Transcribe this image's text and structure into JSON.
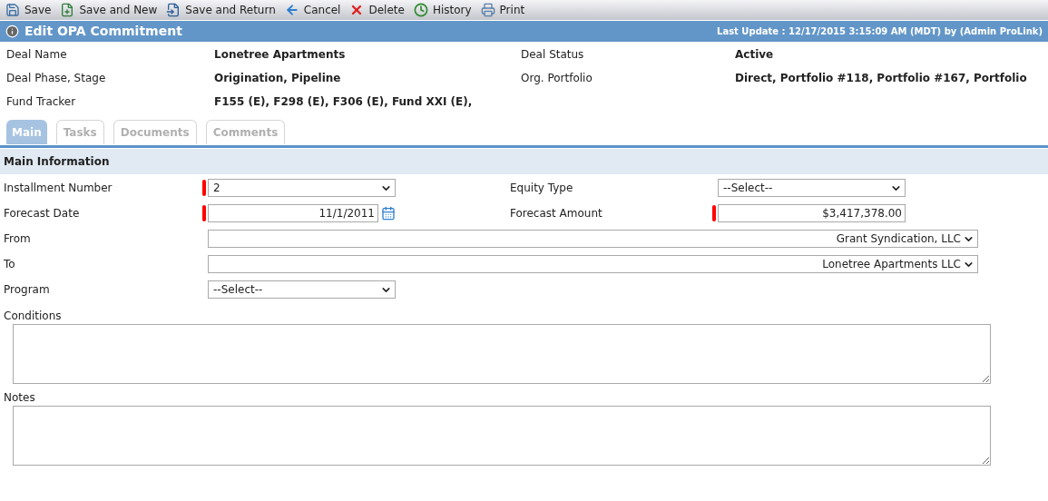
{
  "toolbar": [
    {
      "label": "Save",
      "kind": "save"
    },
    {
      "label": "Save and New",
      "kind": "new"
    },
    {
      "label": "Save and Return",
      "kind": "return"
    },
    {
      "label": "Cancel",
      "kind": "cancel"
    },
    {
      "label": "Delete",
      "kind": "delete"
    },
    {
      "label": "History",
      "kind": "history"
    },
    {
      "label": "Print",
      "kind": "print"
    }
  ],
  "header": {
    "title": "Edit OPA Commitment",
    "last_update": "Last Update : 12/17/2015 3:15:09 AM (MDT) by (Admin ProLink)"
  },
  "summary": [
    {
      "label": "Deal Name",
      "value": "Lonetree Apartments",
      "label_2": "Deal Status",
      "value_2": "Active"
    },
    {
      "label": "Deal Phase, Stage",
      "value": "Origination, Pipeline",
      "label_2": "Org. Portfolio",
      "value_2": "Direct, Portfolio #118, Portfolio #167, Portfolio"
    },
    {
      "label": "Fund Tracker",
      "value": "F155 (E), F298 (E), F306 (E), Fund XXI (E),"
    }
  ],
  "tabs": [
    {
      "label": "Main",
      "selected": true
    },
    {
      "label": "Tasks",
      "selected": false
    },
    {
      "label": "Documents",
      "selected": false
    },
    {
      "label": "Comments",
      "selected": false
    }
  ],
  "section": {
    "title": "Main Information"
  },
  "form_rows": [
    {
      "fields": [
        {
          "label": "Installment Number",
          "kind": "select",
          "value": "2",
          "required": true
        },
        {
          "label": "Equity Type",
          "kind": "select",
          "value": "--Select--",
          "required": false
        }
      ]
    },
    {
      "fields": [
        {
          "label": "Forecast Date",
          "kind": "date",
          "value": "11/1/2011",
          "required": true
        },
        {
          "label": "Forecast Amount",
          "kind": "text",
          "value": "$3,417,378.00",
          "required": true
        }
      ]
    },
    {
      "fields": [
        {
          "label": "From",
          "kind": "wide-select",
          "value": "Grant Syndication, LLC",
          "required": false
        }
      ]
    },
    {
      "fields": [
        {
          "label": "To",
          "kind": "wide-select",
          "value": "Lonetree Apartments LLC",
          "required": false
        }
      ]
    },
    {
      "fields": [
        {
          "label": "Program",
          "kind": "select",
          "value": "--Select--",
          "required": false
        }
      ]
    }
  ],
  "text_areas": [
    {
      "label": "Conditions"
    },
    {
      "label": "Notes"
    }
  ]
}
